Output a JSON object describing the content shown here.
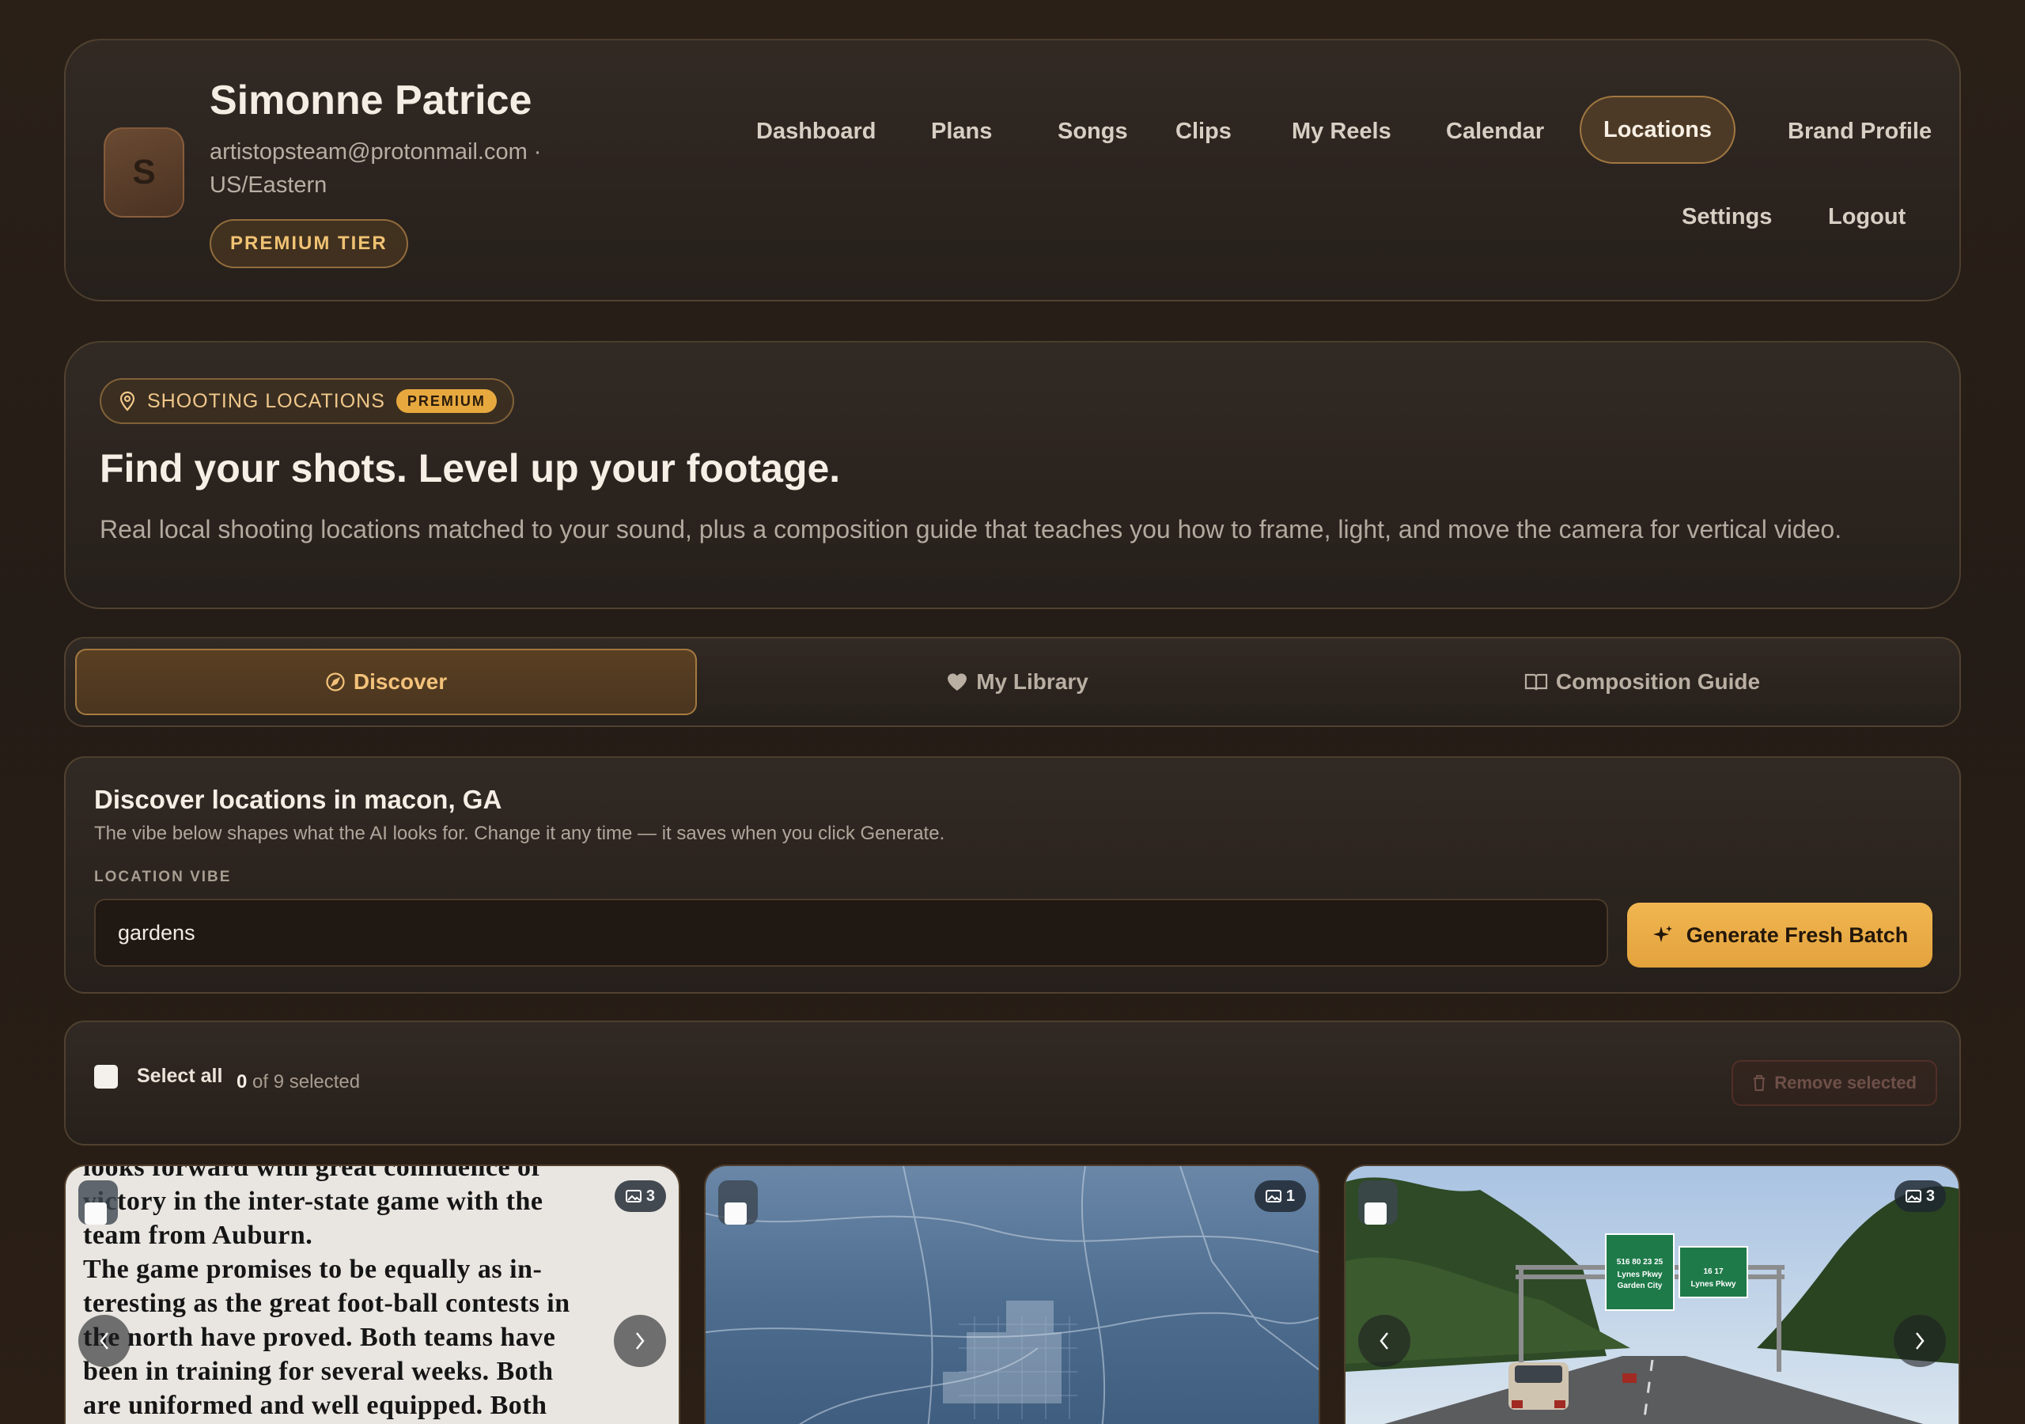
{
  "profile": {
    "initial": "S",
    "name": "Simonne Patrice",
    "email": "artistopsteam@protonmail.com ·",
    "timezone": "US/Eastern",
    "tier": "PREMIUM TIER"
  },
  "nav": {
    "dashboard": "Dashboard",
    "plans": "Plans",
    "songs": "Songs",
    "clips": "Clips",
    "my_reels": "My Reels",
    "calendar": "Calendar",
    "locations": "Locations",
    "brand_profile": "Brand Profile",
    "settings": "Settings",
    "logout": "Logout",
    "active": "Locations"
  },
  "hero": {
    "chip_label": "SHOOTING LOCATIONS",
    "chip_badge": "PREMIUM",
    "title": "Find your shots. Level up your footage.",
    "description": "Real local shooting locations matched to your sound, plus a composition guide that teaches you how to frame, light, and move the camera for vertical video."
  },
  "tabs": {
    "discover": "Discover",
    "library": "My Library",
    "guide": "Composition Guide",
    "active": "Discover"
  },
  "discover": {
    "title": "Discover locations in macon, GA",
    "subtitle": "The vibe below shapes what the AI looks for. Change it any time — it saves when you click Generate.",
    "vibe_label": "LOCATION VIBE",
    "vibe_value": "gardens",
    "generate_label": "Generate Fresh Batch"
  },
  "selection": {
    "select_all": "Select all",
    "selected_count": "0",
    "count_suffix": "of 9 selected",
    "remove_label": "Remove selected"
  },
  "cards": [
    {
      "photo_count": "3",
      "image": "newspaper-clipping",
      "text_lines": [
        "looks forward with great confidence of",
        "victory in the inter-state game with the",
        "team from Auburn.",
        "   The game promises to be equally as in-",
        "teresting as the great foot-ball contests in",
        "the north have proved.  Both teams have",
        "been in training for several weeks.  Both",
        "are uniformed and well equipped.  Both"
      ]
    },
    {
      "photo_count": "1",
      "image": "aerial-city-view"
    },
    {
      "photo_count": "3",
      "image": "highway-overhead-signs",
      "sign_texts": [
        "516",
        "80",
        "23",
        "25",
        "Lynes Pkwy",
        "Garden City",
        "16",
        "17",
        "Lynes Pkwy"
      ]
    }
  ],
  "colors": {
    "accent": "#e7a83e",
    "accent_text": "#f0c373",
    "background": "#261d16",
    "panel_border": "#6e583c"
  }
}
